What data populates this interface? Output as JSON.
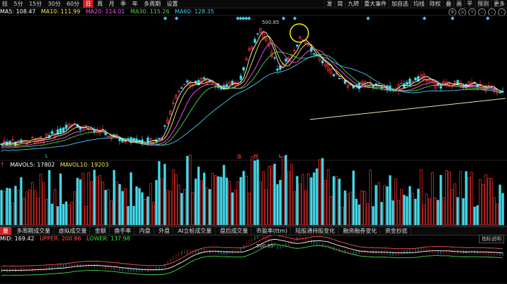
{
  "toolbar": {
    "left": [
      "技",
      "5分",
      "15分",
      "30分",
      "60分",
      "日",
      "周",
      "月",
      "季",
      "年",
      "多周期",
      "设置"
    ],
    "active": "日",
    "right": [
      "发",
      "简",
      "九转",
      "重大事件",
      "加自选",
      "均线",
      "除权",
      "叠",
      "画",
      "平",
      "预测",
      "更多"
    ]
  },
  "legend": [
    {
      "label": "MA5: 108.47",
      "color": "#ffffff"
    },
    {
      "label": "MA10: 111.99",
      "color": "#ffee44"
    },
    {
      "label": "MA20: 114.01",
      "color": "#ff55ff"
    },
    {
      "label": "MA30: 115.26",
      "color": "#44dd44"
    },
    {
      "label": "MA60: 128.35",
      "color": "#44ccee"
    }
  ],
  "chart_labels": {
    "peak": "500.85",
    "zt": "涨",
    "lh": "榜",
    "l1": "L",
    "l2": "L"
  },
  "volume_legend": [
    {
      "label": "MAVOL5: 17802",
      "color": "#ffffff"
    },
    {
      "label": "MAVOL10: 19203",
      "color": "#ffee44"
    }
  ],
  "tabs": [
    "量",
    "多周期成交量",
    "虚拟成交量",
    "金额",
    "换手率",
    "内盘",
    "外盘",
    "AI立桩成交量",
    "盘后成交量",
    "市盈率(ttm)",
    "陆股通持股变化",
    "融资融券变化",
    "资金抄底"
  ],
  "bollinger_legend": [
    {
      "label": "MID: 169.42",
      "color": "#ffffff"
    },
    {
      "label": "UPPER: 200.86",
      "color": "#ff5555"
    },
    {
      "label": "LOWER: 137.98",
      "color": "#44dd44"
    }
  ],
  "bollinger_peak": "500.85",
  "hint": "指标说明",
  "colors": {
    "up": "#ff3333",
    "down": "#44ddee",
    "bg": "#000000"
  }
}
